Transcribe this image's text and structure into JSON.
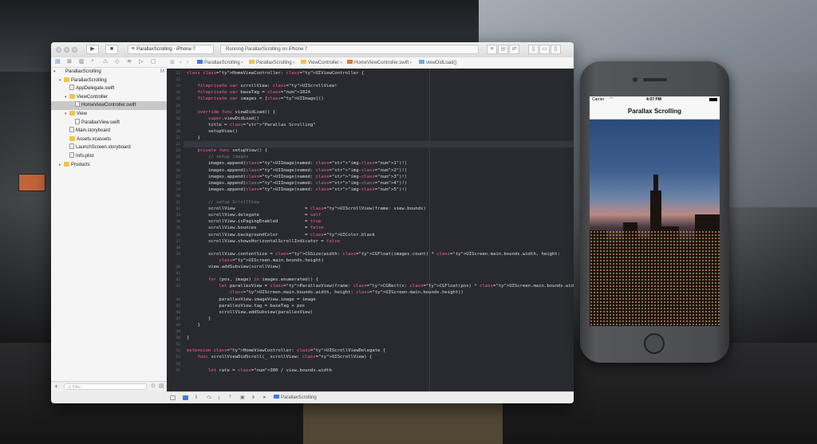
{
  "toolbar": {
    "scheme_project": "ParallaxScrolling",
    "scheme_device": "iPhone 7",
    "status": "Running ParallaxScrolling on iPhone 7"
  },
  "navigator": {
    "items": [
      {
        "label": "ParallaxScrolling",
        "badge": "M",
        "indent": 0,
        "kind": "project",
        "disclosure": "▾"
      },
      {
        "label": "ParallaxScrolling",
        "badge": "",
        "indent": 1,
        "kind": "folder",
        "disclosure": "▾"
      },
      {
        "label": "AppDelegate.swift",
        "badge": "A",
        "indent": 2,
        "kind": "swift",
        "disclosure": ""
      },
      {
        "label": "ViewController",
        "badge": "",
        "indent": 2,
        "kind": "folder",
        "disclosure": "▾"
      },
      {
        "label": "HomeViewController.swift",
        "badge": "A",
        "indent": 3,
        "kind": "swift",
        "disclosure": "",
        "selected": true
      },
      {
        "label": "View",
        "badge": "",
        "indent": 2,
        "kind": "folder",
        "disclosure": "▾"
      },
      {
        "label": "ParallaxView.swift",
        "badge": "A",
        "indent": 3,
        "kind": "swift",
        "disclosure": ""
      },
      {
        "label": "Main.storyboard",
        "badge": "",
        "indent": 2,
        "kind": "swift",
        "disclosure": ""
      },
      {
        "label": "Assets.xcassets",
        "badge": "M",
        "indent": 2,
        "kind": "folder",
        "disclosure": ""
      },
      {
        "label": "LaunchScreen.storyboard",
        "badge": "",
        "indent": 2,
        "kind": "swift",
        "disclosure": ""
      },
      {
        "label": "Info.plist",
        "badge": "",
        "indent": 2,
        "kind": "swift",
        "disclosure": ""
      },
      {
        "label": "Products",
        "badge": "",
        "indent": 1,
        "kind": "folder",
        "disclosure": "▸"
      }
    ],
    "filter_placeholder": "Filter"
  },
  "jumpbar": {
    "crumbs": [
      "ParallaxScrolling",
      "ParallaxScrolling",
      "ViewController",
      "HomeViewController.swift",
      "viewDidLoad()"
    ]
  },
  "editor": {
    "lines": [
      {
        "n": "11",
        "t": "class HomeViewController: UIViewController {"
      },
      {
        "n": "12",
        "t": ""
      },
      {
        "n": "13",
        "t": "    fileprivate var scrollView: UIScrollView!"
      },
      {
        "n": "14",
        "t": "    fileprivate var baseTag = 1024"
      },
      {
        "n": "15",
        "t": "    fileprivate var images = [UIImage]()"
      },
      {
        "n": "16",
        "t": ""
      },
      {
        "n": "17",
        "t": "    override func viewDidLoad() {"
      },
      {
        "n": "18",
        "t": "        super.viewDidLoad()"
      },
      {
        "n": "19",
        "t": "        title = \"Parallax Scrolling\""
      },
      {
        "n": "20",
        "t": "        setupView()"
      },
      {
        "n": "21",
        "t": "    }"
      },
      {
        "n": "22",
        "t": ""
      },
      {
        "n": "23",
        "t": "    private func setupView() {"
      },
      {
        "n": "24",
        "t": "        // setup images"
      },
      {
        "n": "25",
        "t": "        images.append(UIImage(named: \"img-1\")!)"
      },
      {
        "n": "26",
        "t": "        images.append(UIImage(named: \"img-2\")!)"
      },
      {
        "n": "27",
        "t": "        images.append(UIImage(named: \"img-3\")!)"
      },
      {
        "n": "28",
        "t": "        images.append(UIImage(named: \"img-4\")!)"
      },
      {
        "n": "29",
        "t": "        images.append(UIImage(named: \"img-5\")!)"
      },
      {
        "n": "30",
        "t": ""
      },
      {
        "n": "31",
        "t": "        // setup ScrollView"
      },
      {
        "n": "32",
        "t": "        scrollView                          = UIScrollView(frame: view.bounds)"
      },
      {
        "n": "33",
        "t": "        scrollView.delegate                 = self"
      },
      {
        "n": "34",
        "t": "        scrollView.isPagingEnabled          = true"
      },
      {
        "n": "35",
        "t": "        scrollView.bounces                  = false"
      },
      {
        "n": "36",
        "t": "        scrollView.backgroundColor          = UIColor.black"
      },
      {
        "n": "37",
        "t": "        scrollView.showsHorizontalScrollIndicator = false"
      },
      {
        "n": "38",
        "t": ""
      },
      {
        "n": "39",
        "t": "        scrollView.contentSize = CGSize(width: CGFloat(images.count) * UIScreen.main.bounds.width, height:"
      },
      {
        "n": "",
        "t": "            UIScreen.main.bounds.height)"
      },
      {
        "n": "40",
        "t": "        view.addSubview(scrollView)"
      },
      {
        "n": "41",
        "t": ""
      },
      {
        "n": "42",
        "t": "        for (pos, image) in images.enumerated() {"
      },
      {
        "n": "43",
        "t": "            let parallexView = ParallaxView(frame: CGRect(x: CGFloat(pos) * UIScreen.main.bounds.width, y: 0, width:"
      },
      {
        "n": "",
        "t": "                UIScreen.main.bounds.width, height: UIScreen.main.bounds.height))"
      },
      {
        "n": "44",
        "t": "            parallexView.imageView.image = image"
      },
      {
        "n": "45",
        "t": "            parallexView.tag = baseTag + pos"
      },
      {
        "n": "46",
        "t": "            scrollView.addSubview(parallexView)"
      },
      {
        "n": "47",
        "t": "        }"
      },
      {
        "n": "48",
        "t": "    }"
      },
      {
        "n": "49",
        "t": ""
      },
      {
        "n": "50",
        "t": "}"
      },
      {
        "n": "51",
        "t": ""
      },
      {
        "n": "52",
        "t": "extension HomeViewController: UIScrollViewDelegate {"
      },
      {
        "n": "53",
        "t": "    func scrollViewDidScroll(_ scrollView: UIScrollView) {"
      },
      {
        "n": "54",
        "t": ""
      },
      {
        "n": "55",
        "t": "        let rate = 300 / view.bounds.width"
      }
    ]
  },
  "debugbar": {
    "target": "ParallaxScrolling"
  },
  "phone": {
    "carrier": "Carrier",
    "time": "4:07 PM",
    "nav_title": "Parallax Scrolling"
  }
}
